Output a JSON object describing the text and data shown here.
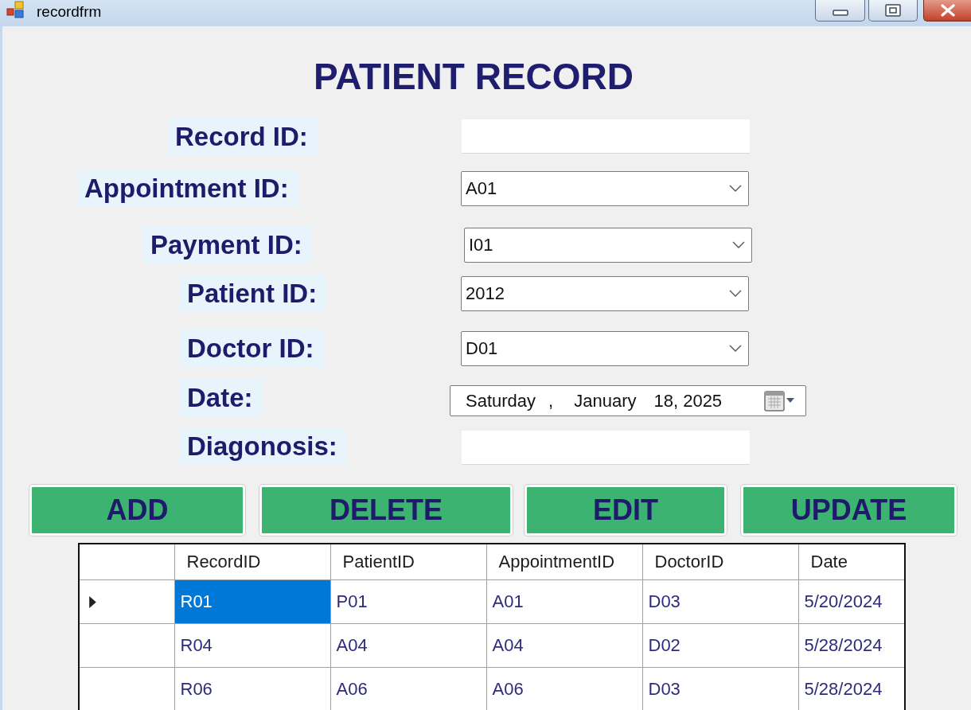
{
  "window": {
    "title": "recordfrm"
  },
  "heading": "PATIENT RECORD",
  "fields": [
    {
      "kind": "text",
      "label": "Record ID:"
    },
    {
      "kind": "combo",
      "label": "Appointment ID:",
      "value": "A01"
    },
    {
      "kind": "combo",
      "label": "Payment ID:",
      "value": "I01"
    },
    {
      "kind": "combo",
      "label": "Patient ID:",
      "value": "2012"
    },
    {
      "kind": "combo",
      "label": "Doctor ID:",
      "value": "D01"
    },
    {
      "kind": "date",
      "label": "Date:",
      "parts": [
        "Saturday",
        ",",
        "January",
        "18, 2025"
      ]
    },
    {
      "kind": "text",
      "label": "Diagonosis:"
    }
  ],
  "buttons": [
    "ADD",
    "DELETE",
    "EDIT",
    "UPDATE"
  ],
  "table": {
    "columns": [
      "RecordID",
      "PatientID",
      "AppointmentID",
      "DoctorID",
      "Date"
    ],
    "rows": [
      {
        "current": true,
        "cells": [
          {
            "text": "R01",
            "selected": true
          },
          {
            "text": "P01",
            "selected": false
          },
          {
            "text": "A01",
            "selected": false
          },
          {
            "text": "D03",
            "selected": false
          },
          {
            "text": "5/20/2024",
            "selected": false
          }
        ]
      },
      {
        "current": false,
        "cells": [
          {
            "text": "R04",
            "selected": false
          },
          {
            "text": "A04",
            "selected": false
          },
          {
            "text": "A04",
            "selected": false
          },
          {
            "text": "D02",
            "selected": false
          },
          {
            "text": "5/28/2024",
            "selected": false
          }
        ]
      },
      {
        "current": false,
        "cells": [
          {
            "text": "R06",
            "selected": false
          },
          {
            "text": "A06",
            "selected": false
          },
          {
            "text": "A06",
            "selected": false
          },
          {
            "text": "D03",
            "selected": false
          },
          {
            "text": "5/28/2024",
            "selected": false
          }
        ]
      }
    ]
  }
}
